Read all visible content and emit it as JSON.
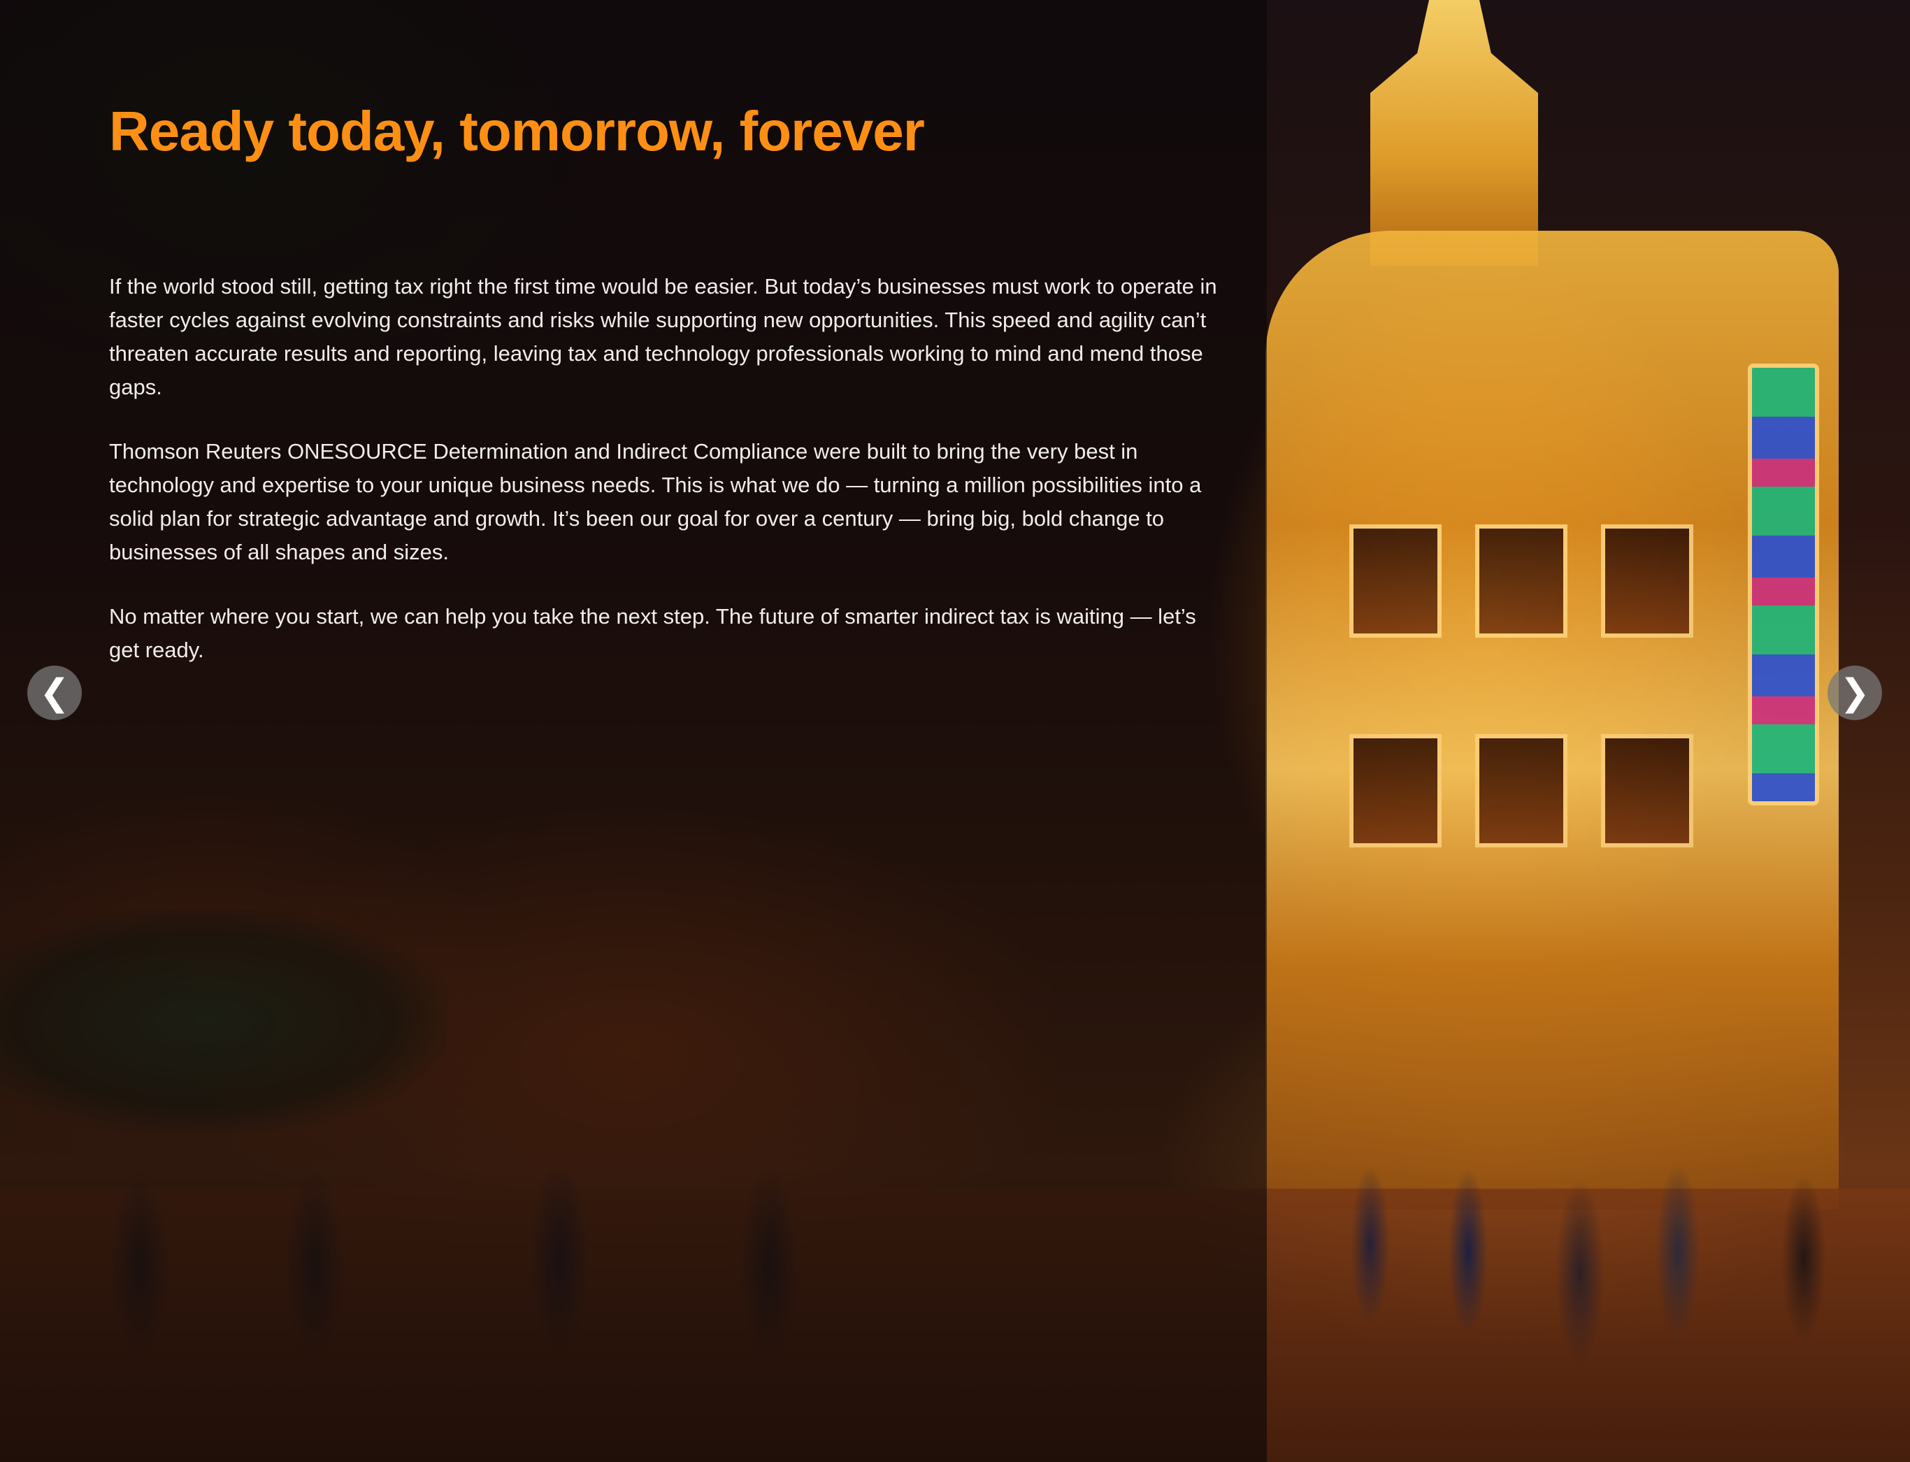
{
  "heading": "Ready today, tomorrow, forever",
  "paragraphs": [
    "If the world stood still, getting tax right the first time would be easier. But today’s businesses must work to operate  in faster cycles against evolving constraints and risks while supporting new opportunities. This speed and agility can’t threaten accurate results and reporting, leaving tax and technology professionals working to mind and mend those gaps.",
    "Thomson Reuters ONESOURCE Determination and Indirect Compliance were  built to bring the very best in technology and expertise to your unique business needs. This is what we do — turning a million possibilities into a solid plan for strategic advantage and growth. It’s been our goal for over a century — bring big, bold change to businesses of all shapes and sizes.",
    "No matter where you start, we can help you take the next step. The future of smarter indirect tax is waiting — let’s get ready."
  ],
  "navigation": {
    "prev_icon": "chevron-left-icon",
    "prev_glyph": "❮",
    "next_icon": "chevron-right-icon",
    "next_glyph": "❯"
  },
  "colors": {
    "heading": "#fe8f15",
    "body_text": "#f1ede9",
    "overlay": "rgba(10,6,8,0.62)"
  }
}
